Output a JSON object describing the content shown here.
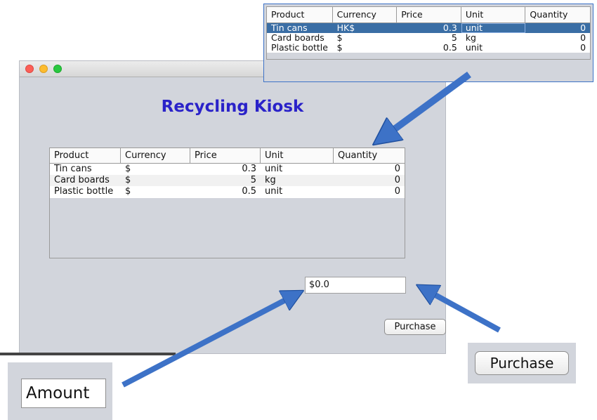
{
  "window": {
    "title": "Recycling Kiosk",
    "columns": [
      "Product",
      "Currency",
      "Price",
      "Unit",
      "Quantity"
    ],
    "rows": [
      {
        "product": "Tin cans",
        "currency": "$",
        "price": "0.3",
        "unit": "unit",
        "quantity": "0"
      },
      {
        "product": "Card boards",
        "currency": "$",
        "price": "5",
        "unit": "kg",
        "quantity": "0"
      },
      {
        "product": "Plastic bottle",
        "currency": "$",
        "price": "0.5",
        "unit": "unit",
        "quantity": "0"
      }
    ],
    "amount_value": "$0.0",
    "purchase_label": "Purchase"
  },
  "zoom_table": {
    "columns": [
      "Product",
      "Currency",
      "Price",
      "Unit",
      "Quantity"
    ],
    "rows": [
      {
        "product": "Tin cans",
        "currency": "HK$",
        "price": "0.3",
        "unit": "unit",
        "quantity": "0",
        "selected": true
      },
      {
        "product": "Card boards",
        "currency": "$",
        "price": "5",
        "unit": "kg",
        "quantity": "0"
      },
      {
        "product": "Plastic bottle",
        "currency": "$",
        "price": "0.5",
        "unit": "unit",
        "quantity": "0"
      }
    ]
  },
  "zoom_amount": {
    "label": "Amount"
  },
  "zoom_purchase": {
    "label": "Purchase"
  },
  "colors": {
    "title": "#2a22c9",
    "arrow": "#3d72c7",
    "selection": "#3a6ea5",
    "window_bg": "#d2d5dc"
  }
}
